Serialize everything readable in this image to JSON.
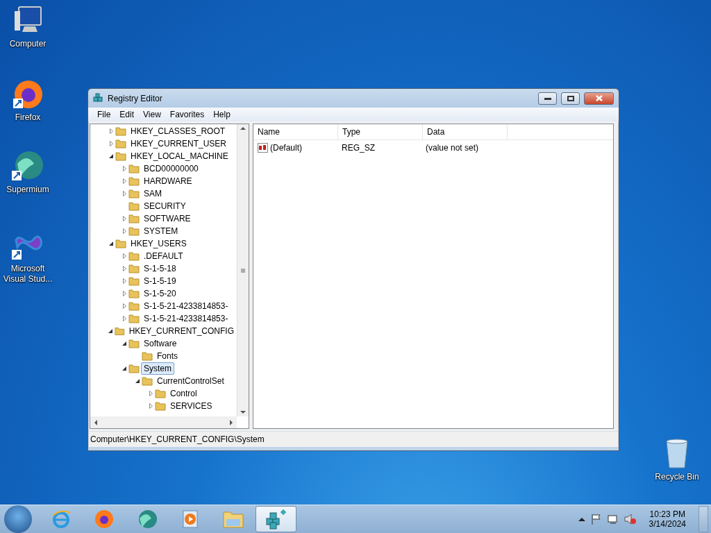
{
  "desktop_icons": [
    {
      "label": "Computer",
      "kind": "computer"
    },
    {
      "label": "Firefox",
      "kind": "firefox"
    },
    {
      "label": "Supermium",
      "kind": "supermium"
    },
    {
      "label": "Microsoft Visual Stud...",
      "kind": "vs"
    }
  ],
  "recycle_bin": {
    "label": "Recycle Bin"
  },
  "window": {
    "title": "Registry Editor",
    "menu": [
      "File",
      "Edit",
      "View",
      "Favorites",
      "Help"
    ],
    "tree": [
      {
        "label": "HKEY_CLASSES_ROOT",
        "kind": "node",
        "expanded": false,
        "selected": false
      },
      {
        "label": "HKEY_CURRENT_USER",
        "kind": "node",
        "expanded": false,
        "selected": false
      },
      {
        "label": "HKEY_LOCAL_MACHINE",
        "kind": "node",
        "expanded": true,
        "selected": false,
        "children": [
          {
            "label": "BCD00000000",
            "kind": "node",
            "expanded": false,
            "selected": false
          },
          {
            "label": "HARDWARE",
            "kind": "node",
            "expanded": false,
            "selected": false
          },
          {
            "label": "SAM",
            "kind": "node",
            "expanded": false,
            "selected": false
          },
          {
            "label": "SECURITY",
            "kind": "leaf",
            "selected": false
          },
          {
            "label": "SOFTWARE",
            "kind": "node",
            "expanded": false,
            "selected": false
          },
          {
            "label": "SYSTEM",
            "kind": "node",
            "expanded": false,
            "selected": false
          }
        ]
      },
      {
        "label": "HKEY_USERS",
        "kind": "node",
        "expanded": true,
        "selected": false,
        "children": [
          {
            "label": ".DEFAULT",
            "kind": "node",
            "expanded": false,
            "selected": false
          },
          {
            "label": "S-1-5-18",
            "kind": "node",
            "expanded": false,
            "selected": false
          },
          {
            "label": "S-1-5-19",
            "kind": "node",
            "expanded": false,
            "selected": false
          },
          {
            "label": "S-1-5-20",
            "kind": "node",
            "expanded": false,
            "selected": false
          },
          {
            "label": "S-1-5-21-4233814853-",
            "kind": "node",
            "expanded": false,
            "selected": false
          },
          {
            "label": "S-1-5-21-4233814853-",
            "kind": "node",
            "expanded": false,
            "selected": false
          }
        ]
      },
      {
        "label": "HKEY_CURRENT_CONFIG",
        "kind": "node",
        "expanded": true,
        "selected": false,
        "children": [
          {
            "label": "Software",
            "kind": "node",
            "expanded": true,
            "selected": false,
            "children": [
              {
                "label": "Fonts",
                "kind": "leaf",
                "selected": false
              }
            ]
          },
          {
            "label": "System",
            "kind": "node",
            "expanded": true,
            "selected": true,
            "children": [
              {
                "label": "CurrentControlSet",
                "kind": "node",
                "expanded": true,
                "selected": false,
                "children": [
                  {
                    "label": "Control",
                    "kind": "node",
                    "expanded": false,
                    "selected": false
                  },
                  {
                    "label": "SERVICES",
                    "kind": "node",
                    "expanded": false,
                    "selected": false
                  }
                ]
              }
            ]
          }
        ]
      }
    ],
    "columns": [
      "Name",
      "Type",
      "Data"
    ],
    "rows": [
      {
        "name": "(Default)",
        "type": "REG_SZ",
        "data": "(value not set)"
      }
    ],
    "status_bar": "Computer\\HKEY_CURRENT_CONFIG\\System"
  },
  "taskbar": {
    "apps": [
      {
        "kind": "ie",
        "selected": false
      },
      {
        "kind": "firefox",
        "selected": false
      },
      {
        "kind": "supermium",
        "selected": false
      },
      {
        "kind": "media",
        "selected": false
      },
      {
        "kind": "explorer",
        "selected": false
      },
      {
        "kind": "regedit",
        "selected": true
      }
    ],
    "time": "10:23 PM",
    "date": "3/14/2024"
  }
}
